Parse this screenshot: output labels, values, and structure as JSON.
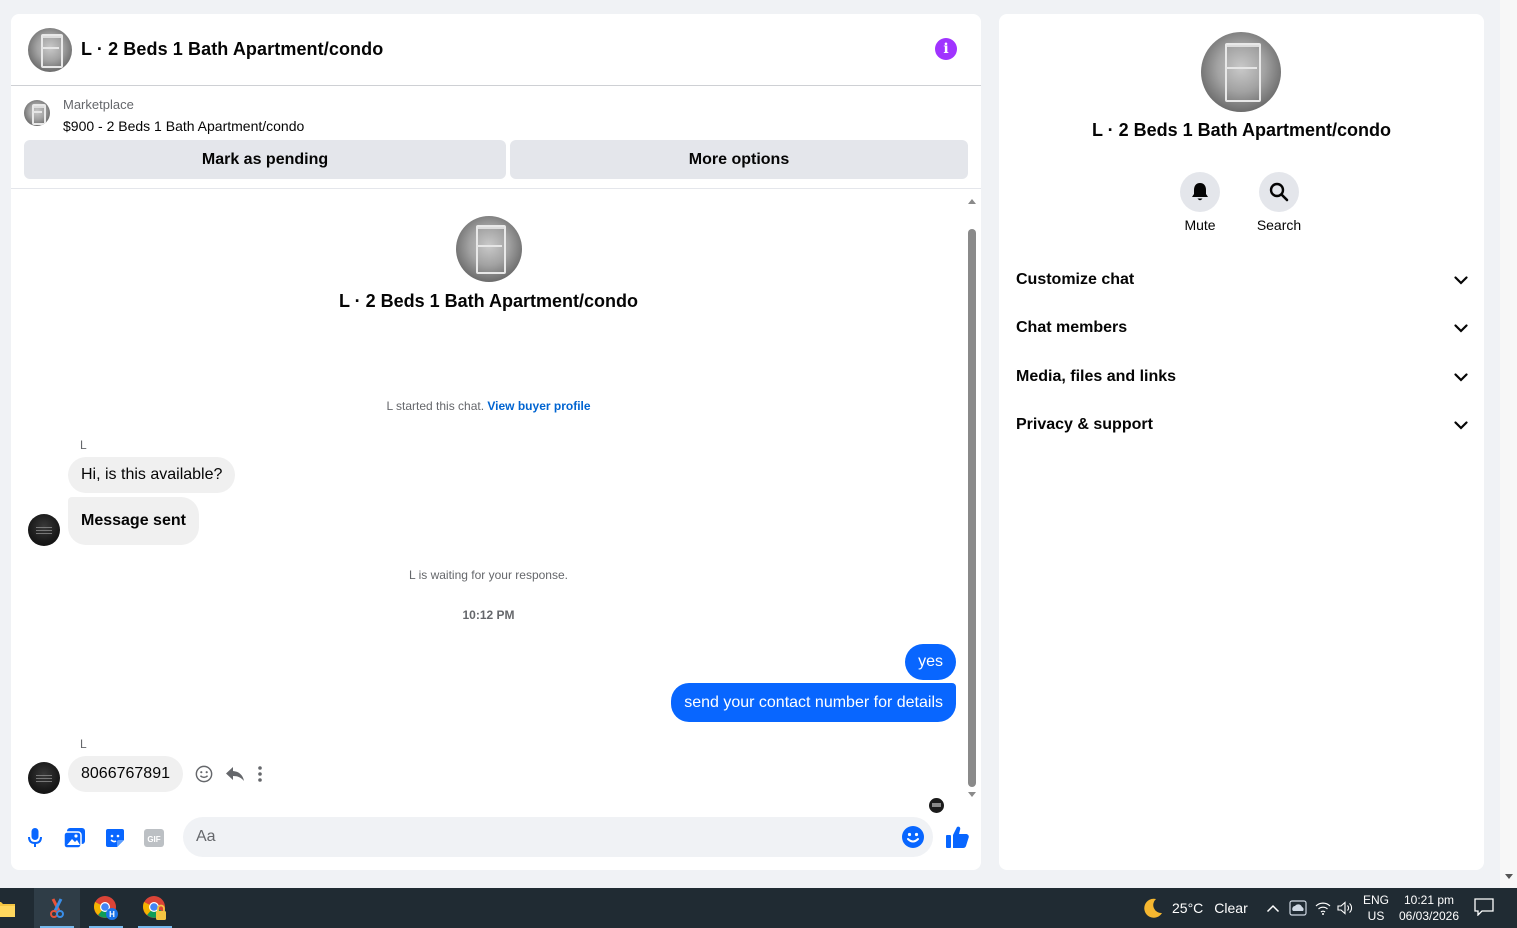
{
  "chat": {
    "header_title": "L · 2 Beds 1 Bath Apartment/condo",
    "info_icon_glyph": "i",
    "marketplace_label": "Marketplace",
    "listing_line": "$900 - 2 Beds 1 Bath Apartment/condo",
    "mark_pending_label": "Mark as pending",
    "more_options_label": "More options",
    "thread_title": "L · 2 Beds 1 Bath Apartment/condo",
    "started_text": "L started this chat.",
    "view_buyer_profile": "View buyer profile",
    "sender_name_1": "L",
    "incoming_1": "Hi, is this available?",
    "incoming_2": "Message sent",
    "waiting_text": "L is waiting for your response.",
    "timestamp": "10:12 PM",
    "outgoing_1": "yes",
    "outgoing_2": "send your contact number for details",
    "sender_name_2": "L",
    "incoming_3": "8066767891",
    "composer_placeholder": "Aa",
    "accent_color": "#0866ff",
    "info_color": "#a033ff"
  },
  "info_panel": {
    "title": "L · 2 Beds 1 Bath Apartment/condo",
    "mute_label": "Mute",
    "search_label": "Search",
    "sections": [
      "Customize chat",
      "Chat members",
      "Media, files and links",
      "Privacy & support"
    ]
  },
  "taskbar": {
    "weather_temp": "25°C",
    "weather_desc": "Clear",
    "lang_top": "ENG",
    "lang_bottom": "US",
    "time": "10:21 pm",
    "date": "06/03/2026"
  }
}
